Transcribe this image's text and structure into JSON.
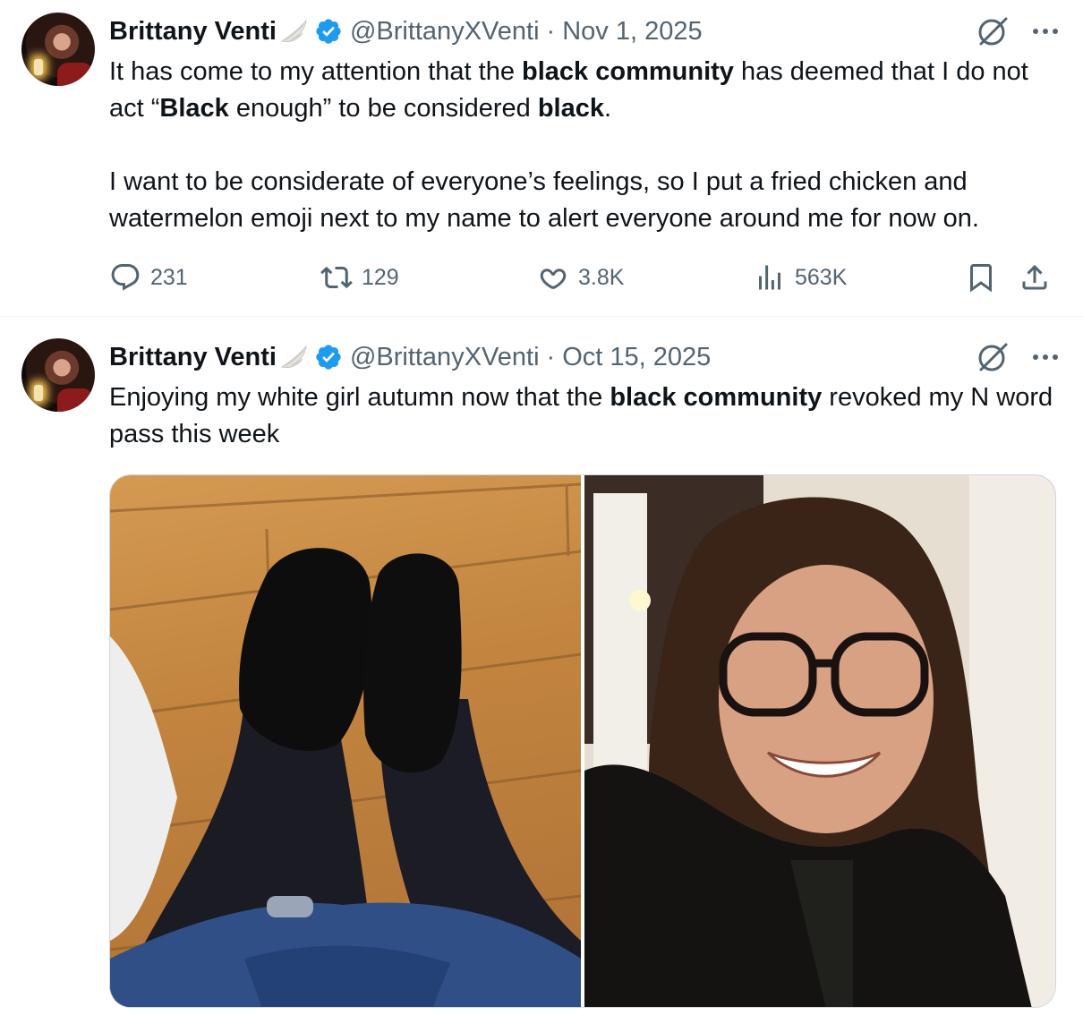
{
  "tweets": [
    {
      "author_name": "Brittany Venti",
      "handle": "@BrittanyXVenti",
      "separator": "·",
      "date": "Nov 1, 2025",
      "paragraphs": [
        [
          {
            "t": "It has come to my attention that the ",
            "b": false
          },
          {
            "t": "black community",
            "b": true
          },
          {
            "t": " has deemed that I do not act “",
            "b": false
          },
          {
            "t": "Black",
            "b": true
          },
          {
            "t": " enough” to be considered ",
            "b": false
          },
          {
            "t": "black",
            "b": true
          },
          {
            "t": ".",
            "b": false
          }
        ],
        [
          {
            "t": "I want to be considerate of everyone’s feelings, so I put a fried chicken and watermelon emoji next to my name to alert everyone around me for now on.",
            "b": false
          }
        ]
      ],
      "stats": {
        "replies": "231",
        "reposts": "129",
        "likes": "3.8K",
        "views": "563K"
      }
    },
    {
      "author_name": "Brittany Venti",
      "handle": "@BrittanyXVenti",
      "separator": "·",
      "date": "Oct 15, 2025",
      "paragraphs": [
        [
          {
            "t": "Enjoying my white girl autumn now that the ",
            "b": false
          },
          {
            "t": "black community",
            "b": true
          },
          {
            "t": " revoked my N word pass this week",
            "b": false
          }
        ]
      ],
      "media": [
        {
          "icon": "photo-boots-on-wood-floor"
        },
        {
          "icon": "photo-selfie-woman-glasses"
        }
      ]
    }
  ],
  "colors": {
    "text": "#0f1419",
    "secondary": "#536471",
    "verified": "#1d9bf0",
    "divider": "#eff3f4"
  },
  "icons": {
    "verified": "verified-badge-icon",
    "badge": "angel-wing-icon",
    "grok": "grok-icon",
    "more": "more-icon",
    "reply": "reply-icon",
    "repost": "repost-icon",
    "like": "heart-icon",
    "views": "views-icon",
    "bookmark": "bookmark-icon",
    "share": "share-icon"
  }
}
